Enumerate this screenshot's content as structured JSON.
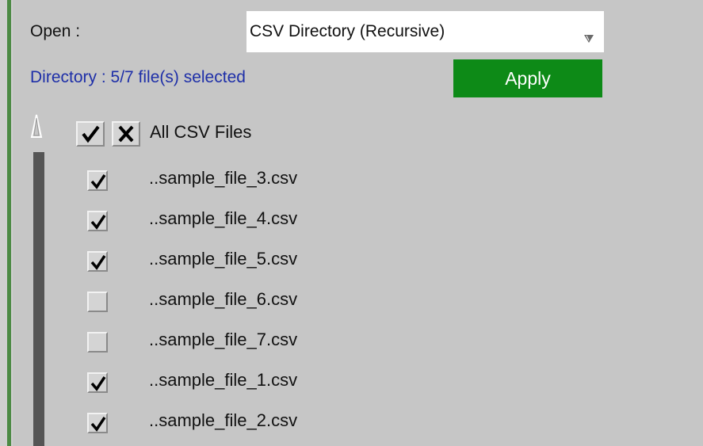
{
  "open": {
    "label": "Open :",
    "selected": "CSV Directory (Recursive)"
  },
  "status": "Directory : 5/7 file(s) selected",
  "apply_label": "Apply",
  "tree": {
    "header_label": "All CSV Files",
    "files": [
      {
        "name": "..sample_file_3.csv",
        "checked": true
      },
      {
        "name": "..sample_file_4.csv",
        "checked": true
      },
      {
        "name": "..sample_file_5.csv",
        "checked": true
      },
      {
        "name": "..sample_file_6.csv",
        "checked": false
      },
      {
        "name": "..sample_file_7.csv",
        "checked": false
      },
      {
        "name": "..sample_file_1.csv",
        "checked": true
      },
      {
        "name": "..sample_file_2.csv",
        "checked": true
      }
    ]
  },
  "colors": {
    "apply_bg": "#0d8a17",
    "status_text": "#1e2fa8",
    "panel_bg": "#c6c6c6",
    "edge_green": "#4c8a44"
  }
}
